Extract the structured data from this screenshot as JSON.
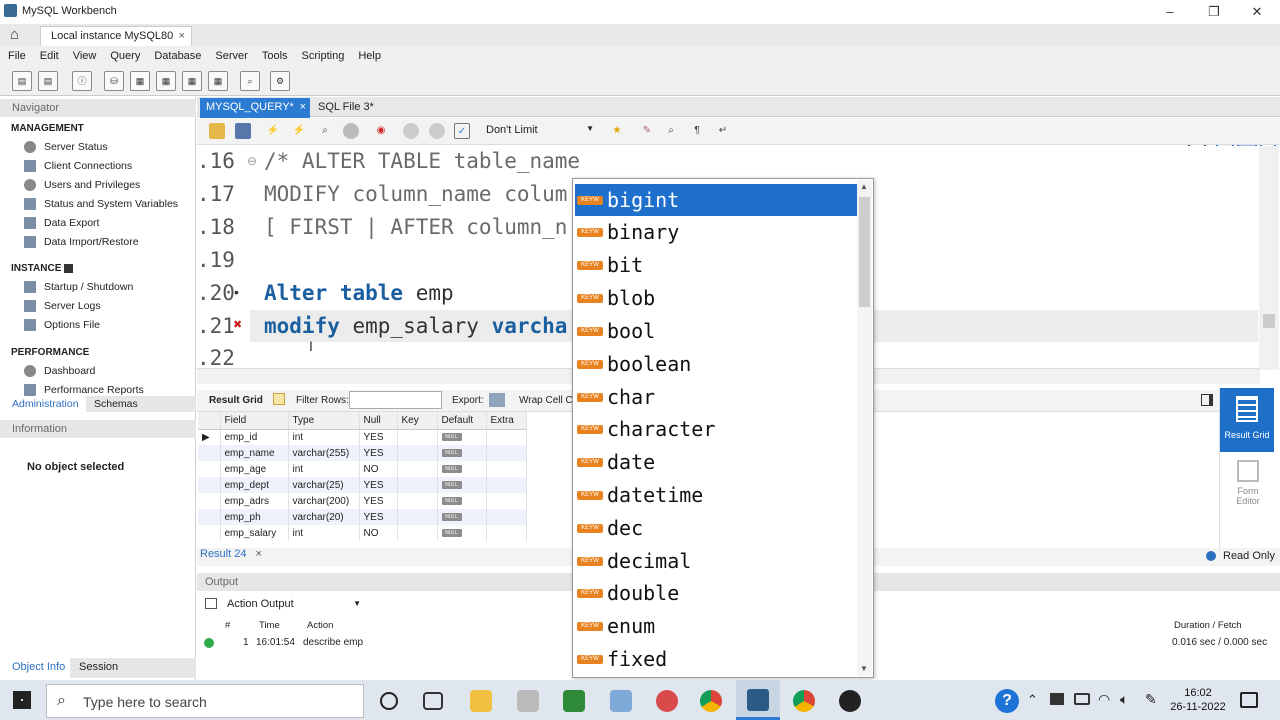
{
  "window": {
    "title": "MySQL Workbench",
    "min": "–",
    "max": "❐",
    "close": "✕"
  },
  "connection_tab": {
    "label": "Local instance MySQL80",
    "close": "×"
  },
  "menu": [
    "File",
    "Edit",
    "View",
    "Query",
    "Database",
    "Server",
    "Tools",
    "Scripting",
    "Help"
  ],
  "sidebar": {
    "navigator_label": "Navigator",
    "management": {
      "title": "MANAGEMENT",
      "items": [
        "Server Status",
        "Client Connections",
        "Users and Privileges",
        "Status and System Variables",
        "Data Export",
        "Data Import/Restore"
      ]
    },
    "instance": {
      "title": "INSTANCE",
      "items": [
        "Startup / Shutdown",
        "Server Logs",
        "Options File"
      ]
    },
    "performance": {
      "title": "PERFORMANCE",
      "items": [
        "Dashboard",
        "Performance Reports"
      ]
    },
    "tabs": [
      "Administration",
      "Schemas"
    ],
    "information_label": "Information",
    "no_object": "No object selected",
    "bottom_tabs": [
      "Object Info",
      "Session"
    ]
  },
  "editor_tabs": {
    "active": "MYSQL_QUERY*",
    "other": "SQL File 3*",
    "close": "×"
  },
  "editor_toolbar": {
    "limit": "Don't Limit"
  },
  "editor": {
    "lines": [
      {
        "num": ".16",
        "marker": "⊖",
        "text": "/* ALTER TABLE table_name"
      },
      {
        "num": ".17",
        "marker": "",
        "text": "MODIFY column_name colum"
      },
      {
        "num": ".18",
        "marker": "",
        "text": "[ FIRST | AFTER column_n"
      },
      {
        "num": ".19",
        "marker": "",
        "text": ""
      },
      {
        "num": ".20",
        "marker": "•",
        "kw": "Alter table",
        "text": " emp"
      },
      {
        "num": ".21",
        "marker": "✖",
        "kw": "modify",
        "text": " emp_salary ",
        "kw2": "varcha"
      },
      {
        "num": ".22",
        "marker": "",
        "text": ""
      }
    ]
  },
  "result_toolbar": {
    "result_grid": "Result Grid",
    "filter_rows": "Filter Rows:",
    "export": "Export:",
    "wrap": "Wrap Cell Co"
  },
  "grid": {
    "columns": [
      "",
      "Field",
      "Type",
      "Null",
      "Key",
      "Default",
      "Extra"
    ],
    "rows": [
      {
        "field": "emp_id",
        "type": "int",
        "null": "YES",
        "key": "",
        "default": "NULL",
        "extra": ""
      },
      {
        "field": "emp_name",
        "type": "varchar(255)",
        "null": "YES",
        "key": "",
        "default": "NULL",
        "extra": ""
      },
      {
        "field": "emp_age",
        "type": "int",
        "null": "NO",
        "key": "",
        "default": "NULL",
        "extra": ""
      },
      {
        "field": "emp_dept",
        "type": "varchar(25)",
        "null": "YES",
        "key": "",
        "default": "NULL",
        "extra": ""
      },
      {
        "field": "emp_adrs",
        "type": "varchar(200)",
        "null": "YES",
        "key": "",
        "default": "NULL",
        "extra": ""
      },
      {
        "field": "emp_ph",
        "type": "varchar(20)",
        "null": "YES",
        "key": "",
        "default": "NULL",
        "extra": ""
      },
      {
        "field": "emp_salary",
        "type": "int",
        "null": "NO",
        "key": "",
        "default": "NULL",
        "extra": ""
      }
    ]
  },
  "right_panel": {
    "result_grid": "Result Grid",
    "form_editor": "Form Editor"
  },
  "result_tab": {
    "label": "Result 24",
    "close": "×",
    "read_only": "Read Only"
  },
  "output": {
    "header": "Output",
    "selector": "Action Output",
    "columns": [
      "#",
      "Time",
      "Action",
      "Duration / Fetch"
    ],
    "rows": [
      {
        "num": "1",
        "time": "16:01:54",
        "action": "describe emp",
        "duration": "0.016 sec / 0.000 sec"
      }
    ]
  },
  "autocomplete": {
    "badge": "KEYW",
    "selected_index": 0,
    "items": [
      "bigint",
      "binary",
      "bit",
      "blob",
      "bool",
      "boolean",
      "char",
      "character",
      "date",
      "datetime",
      "dec",
      "decimal",
      "double",
      "enum",
      "fixed"
    ]
  },
  "taskbar": {
    "search_placeholder": "Type here to search",
    "time": "16:02",
    "date": "26-11-2022"
  },
  "colors": {
    "accent": "#2c7bd3",
    "keyword": "#1a5fa0",
    "badge": "#e8821e"
  }
}
